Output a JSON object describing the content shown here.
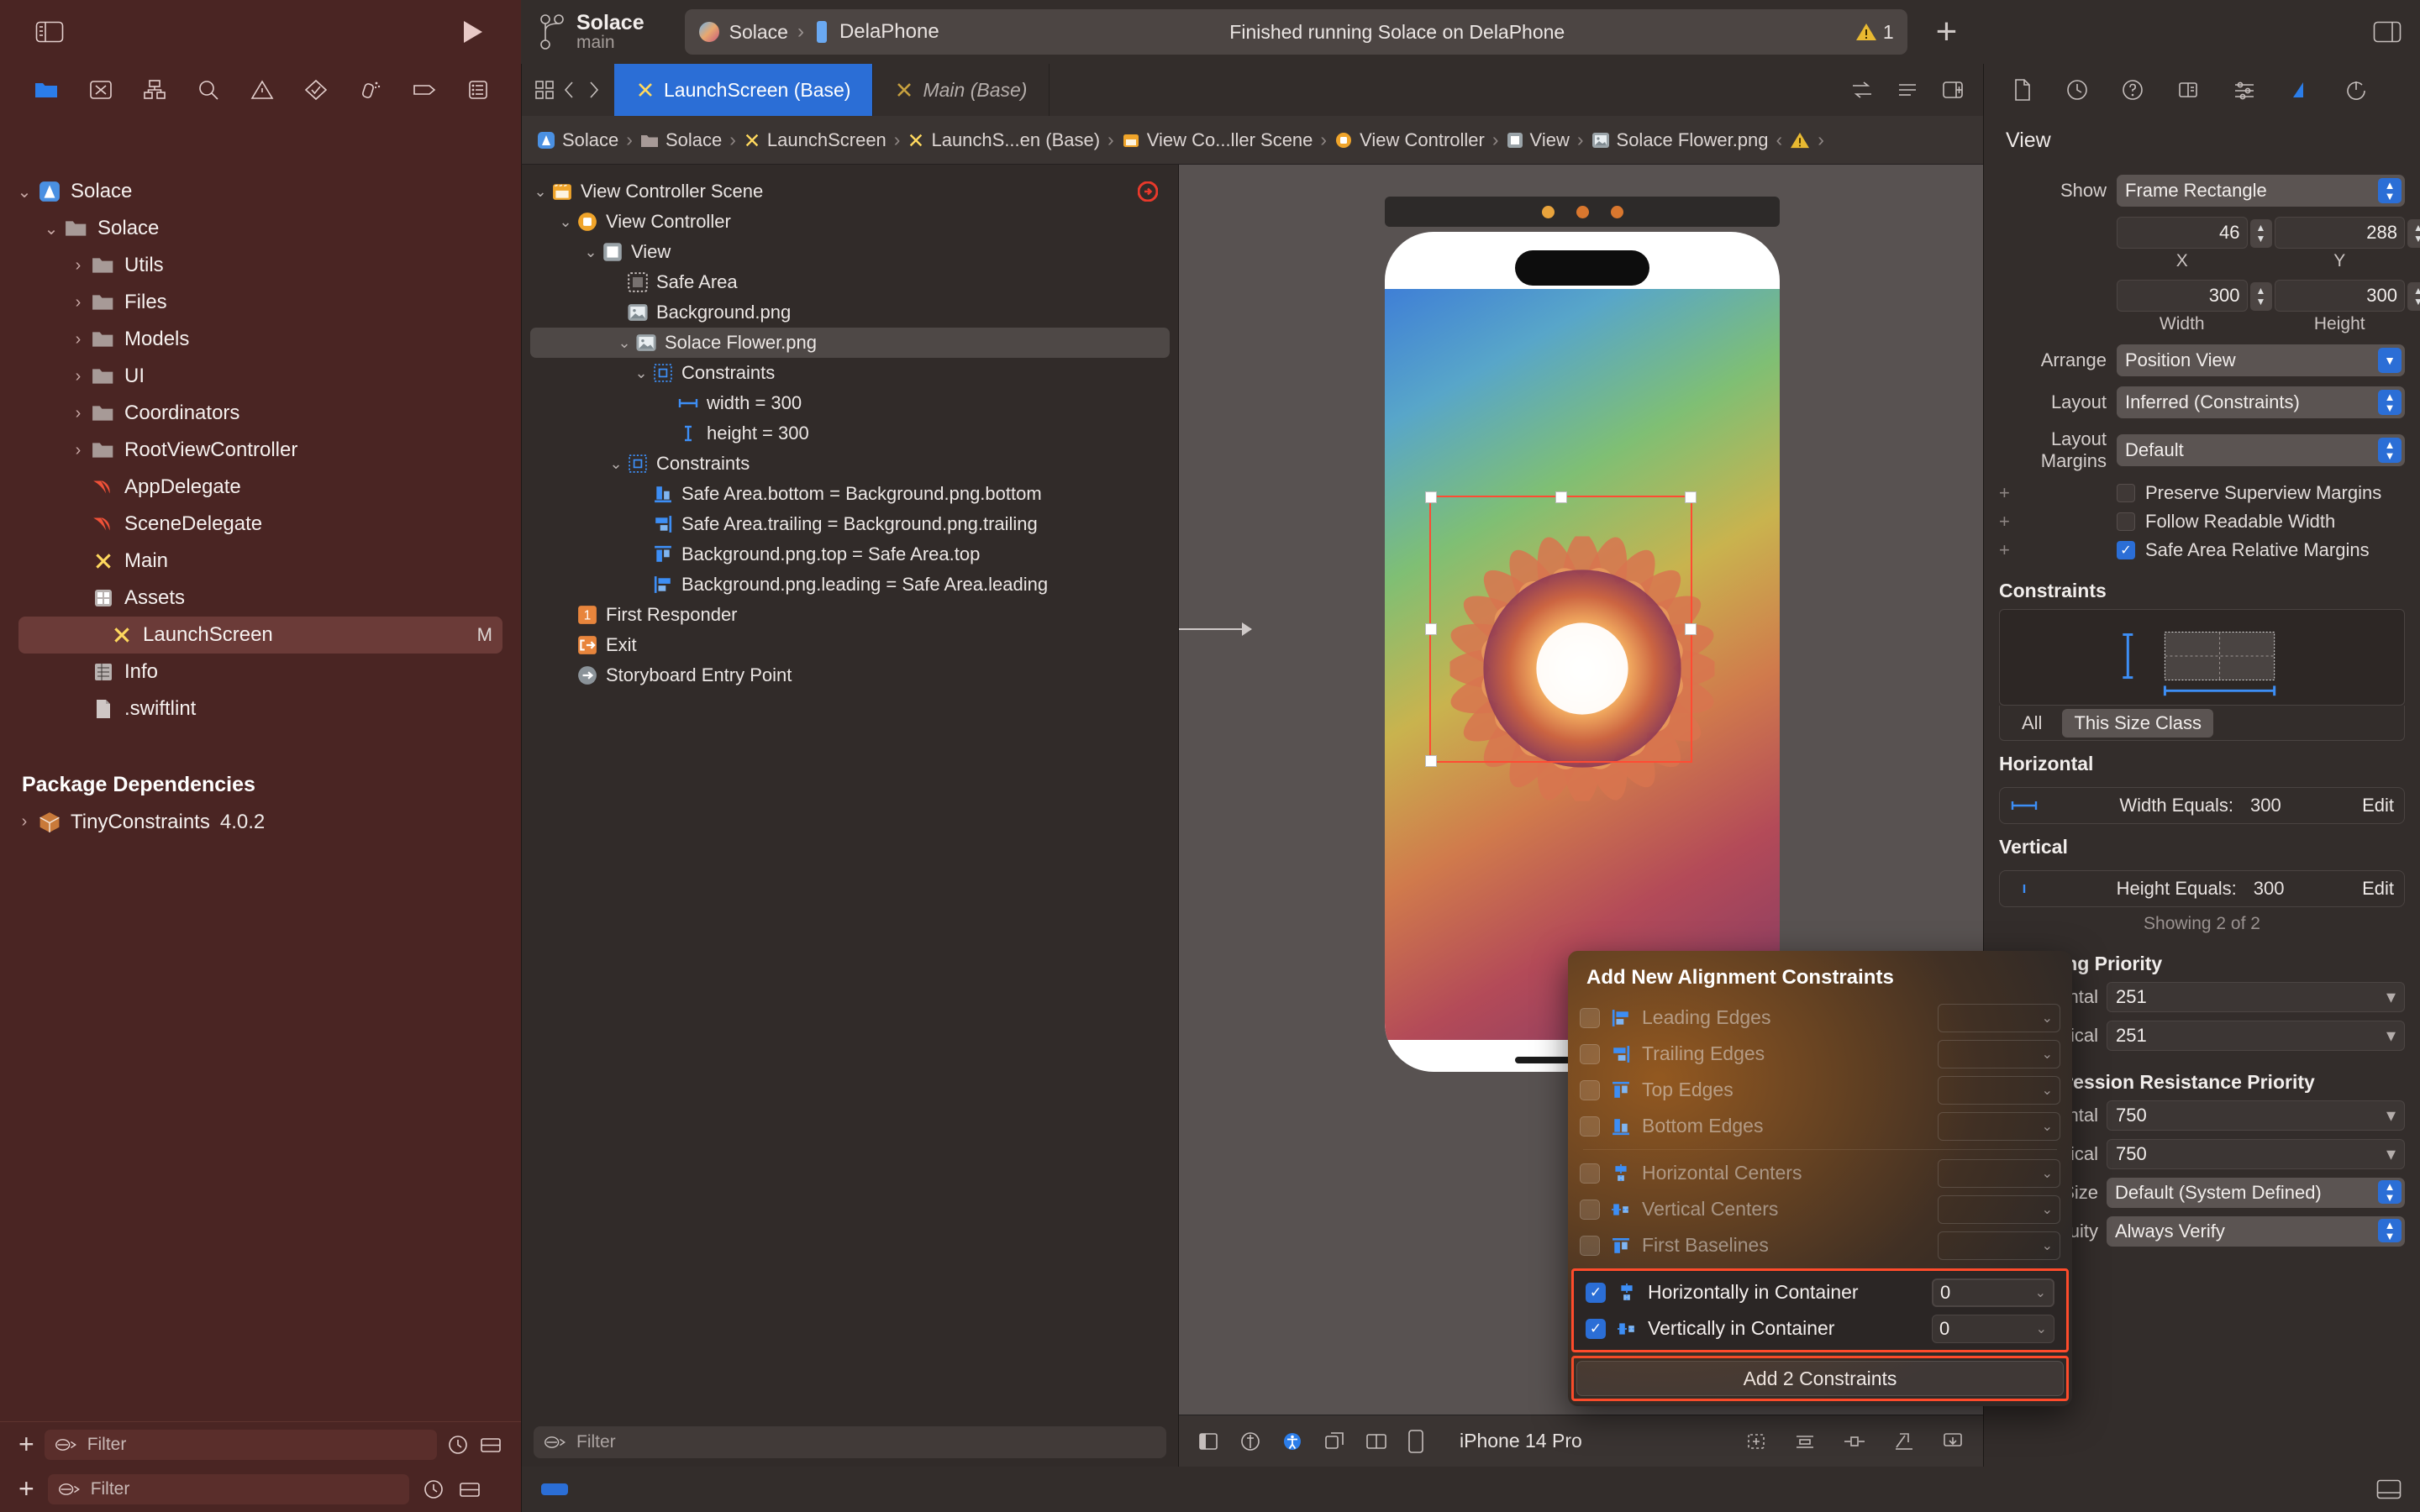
{
  "toolbar": {
    "branch_title": "Solace",
    "branch_sub": "main",
    "scheme": "Solace",
    "destination": "DelaPhone",
    "run_status": "Finished running Solace on DelaPhone",
    "warning_count": "1",
    "plus_label": "+"
  },
  "tabs": [
    {
      "label": "LaunchScreen (Base)",
      "active": true
    },
    {
      "label": "Main (Base)",
      "active": false
    }
  ],
  "breadcrumb": [
    "Solace",
    "Solace",
    "LaunchScreen",
    "LaunchS...en (Base)",
    "View Co...ller Scene",
    "View Controller",
    "View",
    "Solace Flower.png"
  ],
  "navigator": {
    "filter_placeholder": "Filter",
    "items": [
      {
        "label": "Solace",
        "indent": 0,
        "icon": "xcode-project-icon",
        "disc": "open"
      },
      {
        "label": "Solace",
        "indent": 1,
        "icon": "folder-icon",
        "disc": "open"
      },
      {
        "label": "Utils",
        "indent": 2,
        "icon": "folder-icon",
        "disc": "closed"
      },
      {
        "label": "Files",
        "indent": 2,
        "icon": "folder-icon",
        "disc": "closed"
      },
      {
        "label": "Models",
        "indent": 2,
        "icon": "folder-icon",
        "disc": "closed"
      },
      {
        "label": "UI",
        "indent": 2,
        "icon": "folder-icon",
        "disc": "closed"
      },
      {
        "label": "Coordinators",
        "indent": 2,
        "icon": "folder-icon",
        "disc": "closed"
      },
      {
        "label": "RootViewController",
        "indent": 2,
        "icon": "folder-icon",
        "disc": "closed"
      },
      {
        "label": "AppDelegate",
        "indent": 2,
        "icon": "swift-icon",
        "disc": "none"
      },
      {
        "label": "SceneDelegate",
        "indent": 2,
        "icon": "swift-icon",
        "disc": "none"
      },
      {
        "label": "Main",
        "indent": 2,
        "icon": "storyboard-icon",
        "disc": "none"
      },
      {
        "label": "Assets",
        "indent": 2,
        "icon": "assets-icon",
        "disc": "none"
      },
      {
        "label": "LaunchScreen",
        "indent": 2,
        "icon": "storyboard-icon",
        "disc": "none",
        "selected": true,
        "modifier": "M"
      },
      {
        "label": "Info",
        "indent": 2,
        "icon": "plist-icon",
        "disc": "none"
      },
      {
        "label": ".swiftlint",
        "indent": 2,
        "icon": "file-icon",
        "disc": "none"
      }
    ],
    "package_header": "Package Dependencies",
    "packages": [
      {
        "label": "TinyConstraints",
        "version": "4.0.2",
        "icon": "package-icon"
      }
    ]
  },
  "outline": {
    "filter_placeholder": "Filter",
    "items": [
      {
        "label": "View Controller Scene",
        "indent": 0,
        "icon": "scene-icon",
        "disc": "open",
        "trailing": "entrypoint-badge"
      },
      {
        "label": "View Controller",
        "indent": 1,
        "icon": "viewcontroller-icon",
        "disc": "open"
      },
      {
        "label": "View",
        "indent": 2,
        "icon": "view-icon",
        "disc": "open"
      },
      {
        "label": "Safe Area",
        "indent": 3,
        "icon": "safearea-icon",
        "disc": "none"
      },
      {
        "label": "Background.png",
        "indent": 3,
        "icon": "image-icon",
        "disc": "none"
      },
      {
        "label": "Solace Flower.png",
        "indent": 3,
        "icon": "image-icon",
        "disc": "open",
        "selected": true
      },
      {
        "label": "Constraints",
        "indent": 4,
        "icon": "constraints-icon",
        "disc": "open"
      },
      {
        "label": "width = 300",
        "indent": 5,
        "icon": "width-icon",
        "disc": "none"
      },
      {
        "label": "height = 300",
        "indent": 5,
        "icon": "height-icon",
        "disc": "none"
      },
      {
        "label": "Constraints",
        "indent": 3,
        "icon": "constraints-icon",
        "disc": "open"
      },
      {
        "label": "Safe Area.bottom = Background.png.bottom",
        "indent": 4,
        "icon": "bottom-edge-icon",
        "disc": "none"
      },
      {
        "label": "Safe Area.trailing = Background.png.trailing",
        "indent": 4,
        "icon": "trailing-edge-icon",
        "disc": "none"
      },
      {
        "label": "Background.png.top = Safe Area.top",
        "indent": 4,
        "icon": "top-edge-icon",
        "disc": "none"
      },
      {
        "label": "Background.png.leading = Safe Area.leading",
        "indent": 4,
        "icon": "leading-edge-icon",
        "disc": "none"
      },
      {
        "label": "First Responder",
        "indent": 1,
        "icon": "first-responder-icon",
        "disc": "none"
      },
      {
        "label": "Exit",
        "indent": 1,
        "icon": "exit-icon",
        "disc": "none"
      },
      {
        "label": "Storyboard Entry Point",
        "indent": 1,
        "icon": "entry-point-icon",
        "disc": "none"
      }
    ]
  },
  "canvas": {
    "device_name": "iPhone 14 Pro"
  },
  "inspector": {
    "title": "View",
    "show_label": "Show",
    "show_value": "Frame Rectangle",
    "x_value": "46",
    "y_value": "288",
    "x_caption": "X",
    "y_caption": "Y",
    "width_value": "300",
    "height_value": "300",
    "width_caption": "Width",
    "height_caption": "Height",
    "arrange_label": "Arrange",
    "arrange_value": "Position View",
    "layout_label": "Layout",
    "layout_value": "Inferred (Constraints)",
    "margins_label": "Layout Margins",
    "margins_value": "Default",
    "checkboxes": [
      {
        "label": "Preserve Superview Margins",
        "checked": false
      },
      {
        "label": "Follow Readable Width",
        "checked": false
      },
      {
        "label": "Safe Area Relative Margins",
        "checked": true
      }
    ],
    "constraints_header": "Constraints",
    "scope_all": "All",
    "scope_size_class": "This Size Class",
    "horizontal_header": "Horizontal",
    "horizontal_constraint": {
      "label": "Width Equals:",
      "value": "300",
      "edit": "Edit"
    },
    "vertical_header": "Vertical",
    "vertical_constraint": {
      "label": "Height Equals:",
      "value": "300",
      "edit": "Edit"
    },
    "showing": "Showing 2 of 2",
    "hugging_header": "t Hugging Priority",
    "hugging": [
      {
        "label": "zontal",
        "value": "251"
      },
      {
        "label": "ertical",
        "value": "251"
      }
    ],
    "compression_header": "t Compression Resistance Priority",
    "compression": [
      {
        "label": "zontal",
        "value": "750"
      },
      {
        "label": "ertical",
        "value": "750"
      }
    ],
    "intrinsic": {
      "label": "c Size",
      "value": "Default (System Defined)"
    },
    "ambiguity": {
      "label": "iguity",
      "value": "Always Verify"
    }
  },
  "alignment_popover": {
    "title": "Add New Alignment Constraints",
    "rows": [
      {
        "label": "Leading Edges",
        "checked": false,
        "icon": "leading-edge-icon",
        "value": ""
      },
      {
        "label": "Trailing Edges",
        "checked": false,
        "icon": "trailing-edge-icon",
        "value": ""
      },
      {
        "label": "Top Edges",
        "checked": false,
        "icon": "top-edge-icon",
        "value": ""
      },
      {
        "label": "Bottom Edges",
        "checked": false,
        "icon": "bottom-edge-icon",
        "value": ""
      }
    ],
    "rows2": [
      {
        "label": "Horizontal Centers",
        "checked": false,
        "icon": "horizontal-center-icon",
        "value": ""
      },
      {
        "label": "Vertical Centers",
        "checked": false,
        "icon": "vertical-center-icon",
        "value": ""
      },
      {
        "label": "First Baselines",
        "checked": false,
        "icon": "baseline-icon",
        "value": ""
      }
    ],
    "container_rows": [
      {
        "label": "Horizontally in Container",
        "checked": true,
        "icon": "horizontal-center-icon",
        "value": "0",
        "focused": true
      },
      {
        "label": "Vertically in Container",
        "checked": true,
        "icon": "vertical-center-icon",
        "value": "0",
        "focused": false
      }
    ],
    "button_label": "Add 2 Constraints"
  },
  "status_bar": {
    "filter_placeholder": "Filter"
  },
  "colors": {
    "accent_blue": "#2b6ed6",
    "nav_background": "#4a2523",
    "panel_background": "#332d2b",
    "highlight_red": "#ff4b2b",
    "warning_yellow": "#e8b931",
    "swift_orange": "#f05138"
  }
}
